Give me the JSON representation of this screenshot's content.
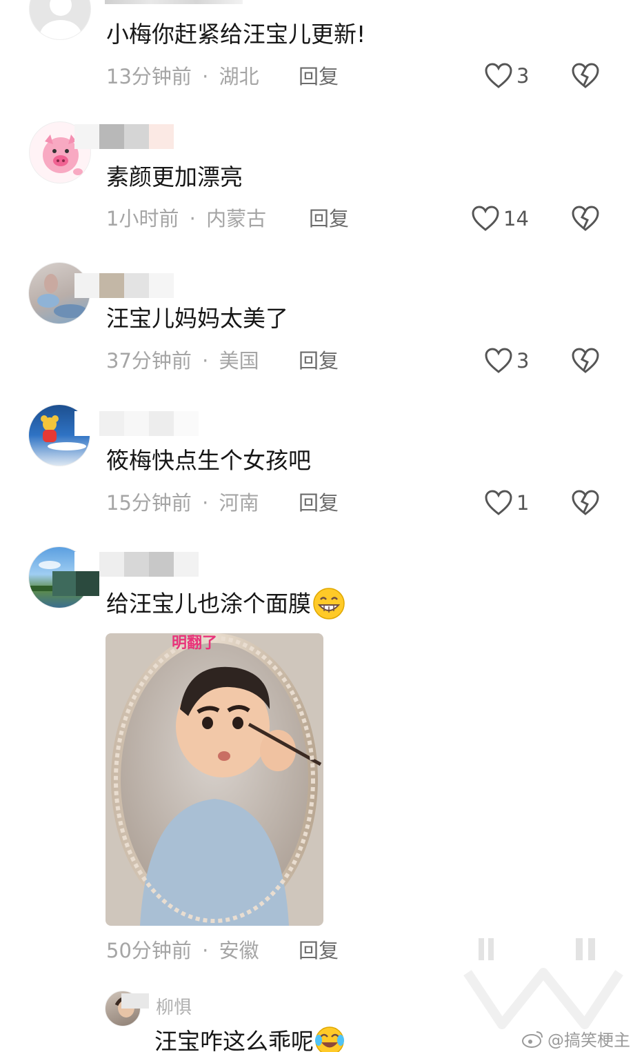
{
  "comments": [
    {
      "text": "小梅你赶紧给汪宝儿更新!",
      "time": "13分钟前",
      "location": "湖北",
      "reply_label": "回复",
      "likes": "3"
    },
    {
      "text": "素颜更加漂亮",
      "time": "1小时前",
      "location": "内蒙古",
      "reply_label": "回复",
      "likes": "14"
    },
    {
      "text": "汪宝儿妈妈太美了",
      "time": "37分钟前",
      "location": "美国",
      "reply_label": "回复",
      "likes": "3"
    },
    {
      "text": "筱梅快点生个女孩吧",
      "time": "15分钟前",
      "location": "河南",
      "reply_label": "回复",
      "likes": "1"
    },
    {
      "text": "给汪宝儿也涂个面膜",
      "emoji": "grinning-face-emoji",
      "time": "50分钟前",
      "location": "安徽",
      "reply_label": "回复",
      "image_caption": "明翻了"
    }
  ],
  "separator": "·",
  "sub_comment": {
    "username": "柳惧",
    "text": "汪宝咋这么乖呢",
    "emoji": "laughing-tears-emoji"
  },
  "watermark": "@搞笑梗主",
  "colors": {
    "text": "#161616",
    "meta": "#a5a5a5",
    "reply": "#6b6b6b",
    "icon": "#555555"
  }
}
